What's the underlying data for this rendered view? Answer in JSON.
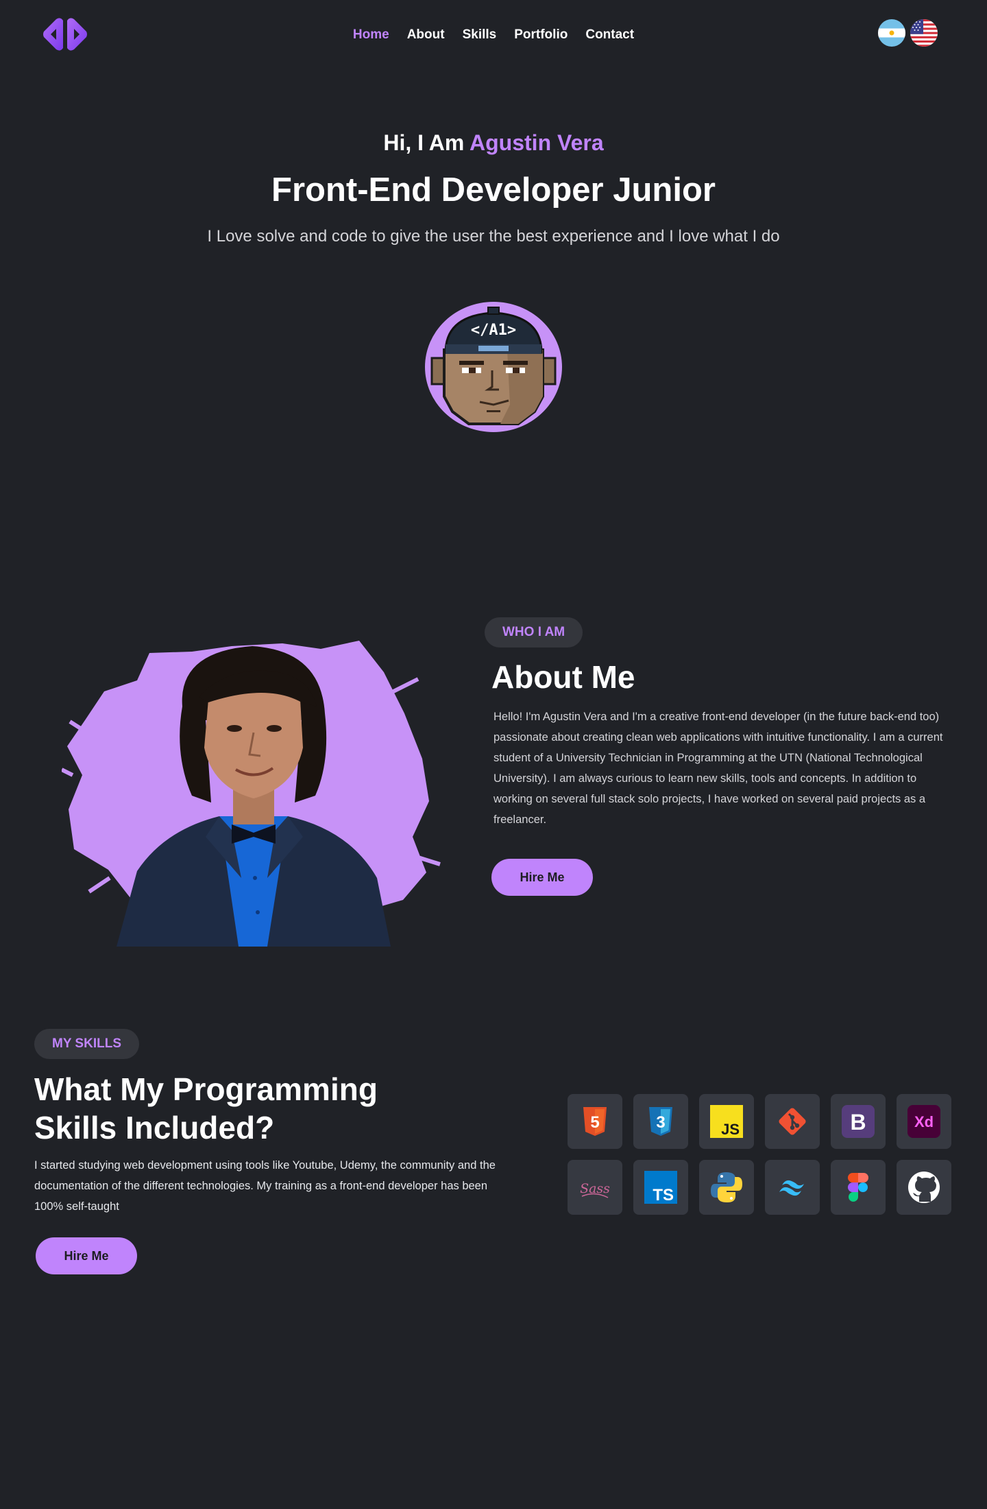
{
  "nav": {
    "links": [
      "Home",
      "About",
      "Skills",
      "Portfolio",
      "Contact"
    ],
    "active": "Home",
    "languages": [
      "Argentina flag",
      "United States flag"
    ]
  },
  "hero": {
    "greeting_prefix": "Hi, I Am ",
    "name": "Agustin Vera",
    "title": "Front-End Developer Junior",
    "subtitle": "I Love solve and code to give the user the best experience and I love what I do",
    "avatar_cap_text": "</A1>"
  },
  "about": {
    "pill": "WHO I AM",
    "heading": "About Me",
    "body": "Hello! I'm Agustin Vera and I'm a creative front-end developer (in the future back-end too) passionate about creating clean web applications with intuitive functionality. I am a current student of a University Technician in Programming at the UTN (National Technological University). I am always curious to learn new skills, tools and concepts. In addition to working on several full stack solo projects, I have worked on several paid projects as a freelancer.",
    "button": "Hire Me"
  },
  "skills": {
    "pill": "MY SKILLS",
    "heading_line1": "What My Programming",
    "heading_line2": "Skills Included?",
    "body": "I started studying web development using tools like Youtube, Udemy, the community and the documentation of the different technologies. My training as a front-end developer has been 100% self-taught",
    "button": "Hire Me",
    "icons": [
      "html5-icon",
      "css3-icon",
      "javascript-icon",
      "git-icon",
      "bootstrap-icon",
      "adobe-xd-icon",
      "sass-icon",
      "typescript-icon",
      "python-icon",
      "tailwind-icon",
      "figma-icon",
      "github-icon"
    ],
    "icon_text": {
      "html": "5",
      "css": "3",
      "js": "JS",
      "bootstrap": "B",
      "xd": "Xd",
      "sass": "Sass",
      "ts": "TS"
    }
  },
  "colors": {
    "background": "#202227",
    "accent": "#c084fc",
    "tile": "#363941",
    "pill": "#34363c"
  }
}
